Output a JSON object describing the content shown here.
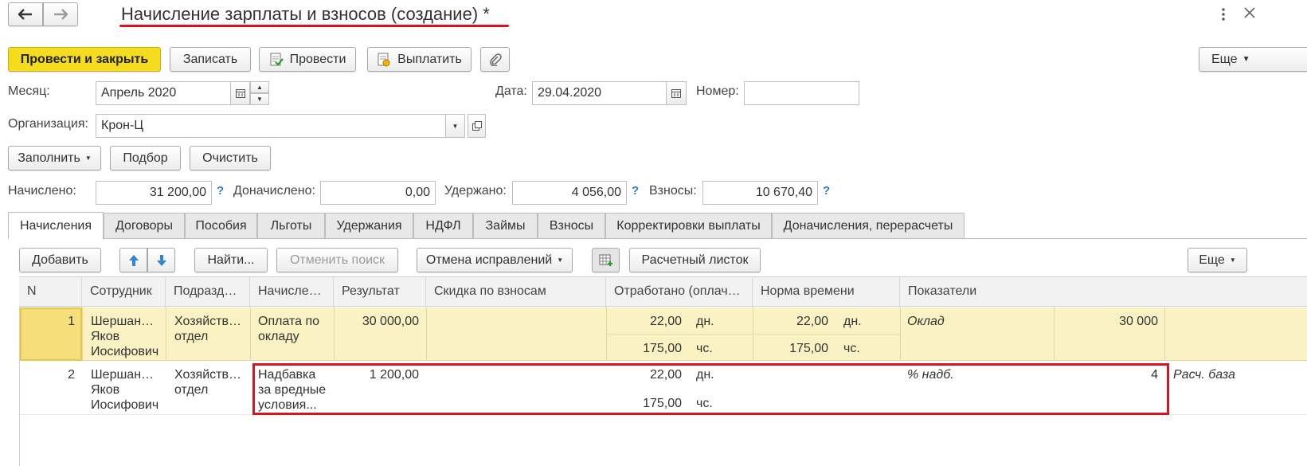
{
  "header": {
    "title": "Начисление зарплаты и взносов (создание) *"
  },
  "toolbar": {
    "post_close": "Провести и закрыть",
    "save": "Записать",
    "post": "Провести",
    "pay": "Выплатить",
    "more": "Еще"
  },
  "form": {
    "month_label": "Месяц:",
    "month_value": "Апрель 2020",
    "date_label": "Дата:",
    "date_value": "29.04.2020",
    "number_label": "Номер:",
    "number_value": "",
    "org_label": "Организация:",
    "org_value": "Крон-Ц"
  },
  "actions": {
    "fill": "Заполнить",
    "select": "Подбор",
    "clear": "Очистить"
  },
  "totals": {
    "accrued_label": "Начислено:",
    "accrued_value": "31 200,00",
    "extra_label": "Доначислено:",
    "extra_value": "0,00",
    "withheld_label": "Удержано:",
    "withheld_value": "4 056,00",
    "contrib_label": "Взносы:",
    "contrib_value": "10 670,40",
    "help": "?"
  },
  "tabs": [
    "Начисления",
    "Договоры",
    "Пособия",
    "Льготы",
    "Удержания",
    "НДФЛ",
    "Займы",
    "Взносы",
    "Корректировки выплаты",
    "Доначисления, перерасчеты"
  ],
  "grid_toolbar": {
    "add": "Добавить",
    "find": "Найти...",
    "cancel_search": "Отменить поиск",
    "cancel_fix": "Отмена исправлений",
    "payslip": "Расчетный листок",
    "more": "Еще"
  },
  "table": {
    "columns": [
      "N",
      "Сотрудник",
      "Подразд…",
      "Начисле…",
      "Результат",
      "Скидка по взносам",
      "Отработано (оплач…",
      "Норма времени",
      "Показатели"
    ],
    "rows": [
      {
        "n": "1",
        "employee": [
          "Шершан…",
          "Яков",
          "Иосифович"
        ],
        "dept": [
          "Хозяйств…",
          "отдел"
        ],
        "accrual": [
          "Оплата по",
          "окладу"
        ],
        "result": "30 000,00",
        "worked_days": "22,00",
        "days_unit": "дн.",
        "worked_hours": "175,00",
        "hours_unit": "чс.",
        "norm_days": "22,00",
        "norm_days_unit": "дн.",
        "norm_hours": "175,00",
        "norm_hours_unit": "чс.",
        "indicator": "Оклад",
        "indicator_value": "30 000"
      },
      {
        "n": "2",
        "employee": [
          "Шершан…",
          "Яков",
          "Иосифович"
        ],
        "dept": [
          "Хозяйств…",
          "отдел"
        ],
        "accrual": [
          "Надбавка",
          "за вредные",
          "условия..."
        ],
        "result": "1 200,00",
        "worked_days": "22,00",
        "days_unit": "дн.",
        "worked_hours": "175,00",
        "hours_unit": "чс.",
        "indicator": "% надб.",
        "indicator_value": "4",
        "indicator2": "Расч. база"
      }
    ]
  },
  "colors": {
    "accent_yellow": "#f5dc1f",
    "selected_row": "#fbf2c4",
    "highlight_red": "#d9141e",
    "help_blue": "#2f7ec7"
  }
}
